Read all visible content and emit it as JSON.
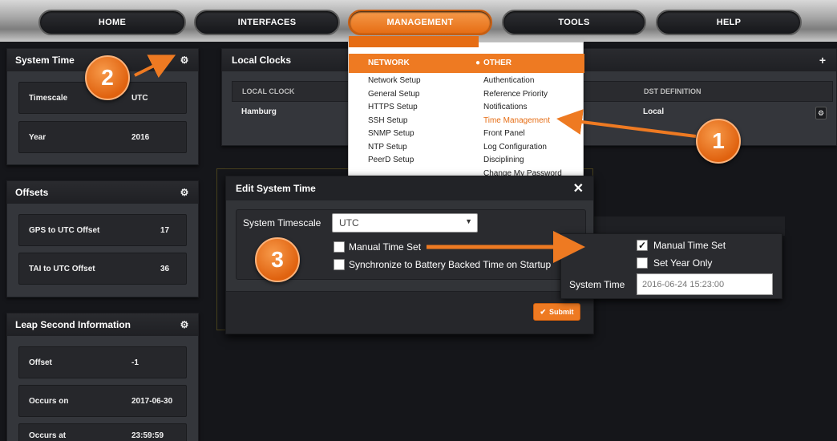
{
  "nav": {
    "items": [
      "HOME",
      "INTERFACES",
      "MANAGEMENT",
      "TOOLS",
      "HELP"
    ],
    "active": "MANAGEMENT"
  },
  "system_time": {
    "title": "System Time",
    "rows": [
      {
        "label": "Timescale",
        "value": "UTC"
      },
      {
        "label": "Year",
        "value": "2016"
      }
    ]
  },
  "offsets": {
    "title": "Offsets",
    "rows": [
      {
        "label": "GPS to UTC Offset",
        "value": "17"
      },
      {
        "label": "TAI to UTC Offset",
        "value": "36"
      }
    ]
  },
  "leap": {
    "title": "Leap Second Information",
    "rows": [
      {
        "label": "Offset",
        "value": "-1"
      },
      {
        "label": "Occurs on",
        "value": "2017-06-30"
      },
      {
        "label": "Occurs at",
        "value": "23:59:59"
      }
    ]
  },
  "local_clocks": {
    "title": "Local Clocks",
    "col_local_clock": "LOCAL CLOCK",
    "col_dst": "DST DEFINITION",
    "row_name": "Hamburg",
    "row_dst": "Local"
  },
  "menu": {
    "network_header": "NETWORK",
    "other_header": "OTHER",
    "network_items": [
      "Network Setup",
      "General Setup",
      "HTTPS Setup",
      "SSH Setup",
      "SNMP Setup",
      "NTP Setup",
      "PeerD Setup"
    ],
    "other_items": [
      "Authentication",
      "Reference Priority",
      "Notifications",
      "Time Management",
      "Front Panel",
      "Log Configuration",
      "Disciplining",
      "Change My Password"
    ],
    "highlighted": "Time Management"
  },
  "modal": {
    "title": "Edit System Time",
    "close_symbol": "✕",
    "timescale_label": "System Timescale",
    "timescale_value": "UTC",
    "manual_time_label": "Manual Time Set",
    "sync_label": "Synchronize to Battery Backed Time on Startup",
    "submit_label": "Submit"
  },
  "callout": {
    "manual_time_label": "Manual Time Set",
    "manual_time_checked": true,
    "set_year_label": "Set Year Only",
    "set_year_checked": false,
    "system_time_label": "System Time",
    "system_time_value": "2016-06-24 15:23:00"
  },
  "badges": [
    "1",
    "2",
    "3"
  ],
  "colors": {
    "accent": "#ee7a22",
    "panel": "#34363b",
    "background": "#15161a"
  },
  "icons": {
    "gear": "gear-icon",
    "close": "close-icon",
    "check": "check-icon",
    "dropdown": "chevron-down-icon"
  }
}
